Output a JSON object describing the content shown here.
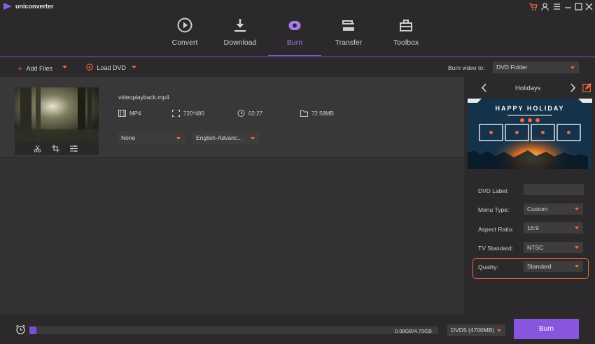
{
  "app": {
    "name": "uniconverter"
  },
  "nav": {
    "tabs": [
      {
        "label": "Convert",
        "icon": "convert-icon"
      },
      {
        "label": "Download",
        "icon": "download-icon"
      },
      {
        "label": "Burn",
        "icon": "burn-icon",
        "active": true
      },
      {
        "label": "Transfer",
        "icon": "transfer-icon"
      },
      {
        "label": "Toolbox",
        "icon": "toolbox-icon"
      }
    ]
  },
  "toolbar": {
    "add_files": "Add Files",
    "load_dvd": "Load DVD",
    "burn_label": "Burn video to:",
    "burn_target": "DVD Folder"
  },
  "video": {
    "filename": "videoplayback.mp4",
    "format": "MP4",
    "resolution": "720*480",
    "duration": "02:27",
    "size": "72.58MB",
    "subtitle": "None",
    "audio": "English-Advanc..."
  },
  "template": {
    "name": "Holidays",
    "preview_text": "HAPPY HOLIDAY"
  },
  "settings": {
    "dvd_label": {
      "label": "DVD Label:",
      "value": ""
    },
    "menu_type": {
      "label": "Menu Type:",
      "value": "Custom"
    },
    "aspect_ratio": {
      "label": "Aspect Ratio:",
      "value": "16:9"
    },
    "tv_standard": {
      "label": "TV Standard:",
      "value": "NTSC"
    },
    "quality": {
      "label": "Quality:",
      "value": "Standard"
    }
  },
  "footer": {
    "progress_text": "0.08GB/4.70GB",
    "progress_fraction": 0.017,
    "disc_type": "DVD5 (4700MB)",
    "burn_button": "Burn"
  },
  "colors": {
    "accent": "#8755de",
    "highlight": "#ef6a3c"
  }
}
